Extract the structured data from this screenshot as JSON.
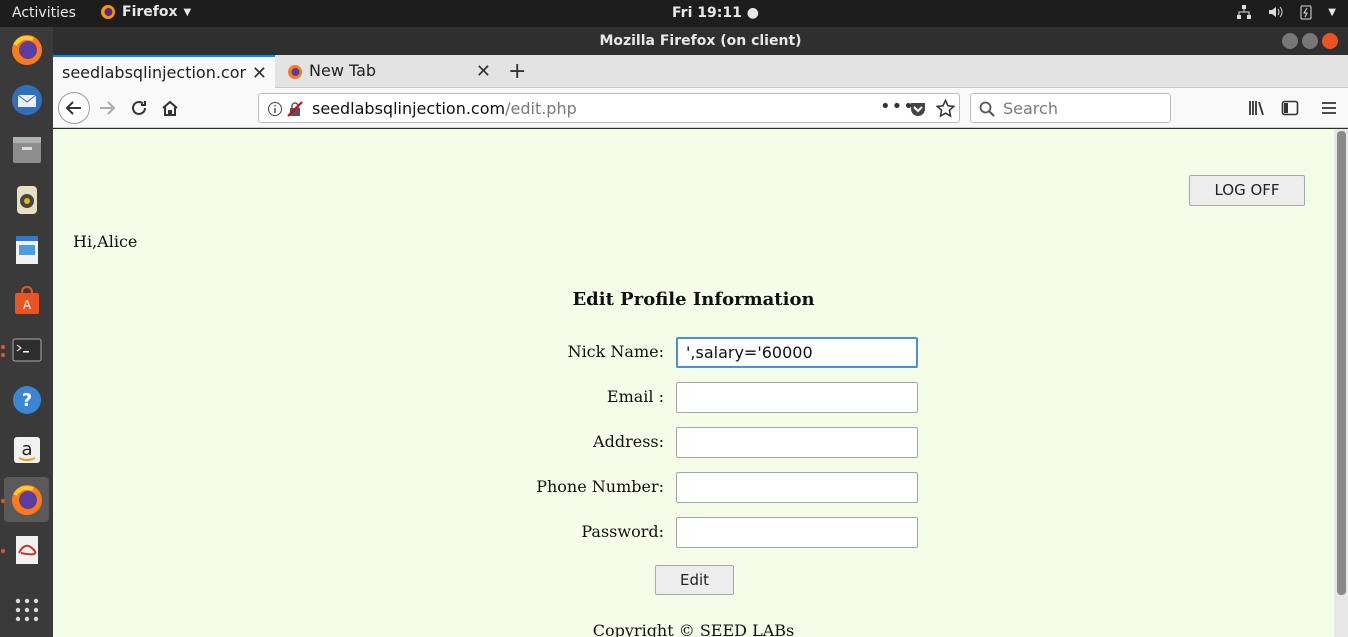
{
  "system": {
    "activities": "Activities",
    "app_name": "Firefox",
    "clock": "Fri 19:11"
  },
  "window": {
    "title": "Mozilla Firefox (on client)"
  },
  "tabs": [
    {
      "label": "seedlabsqlinjection.com/",
      "active": true
    },
    {
      "label": "New Tab",
      "active": false
    }
  ],
  "navbar": {
    "url_host": "seedlabsqlinjection.com",
    "url_path": "/edit.php",
    "search_placeholder": "Search"
  },
  "page": {
    "logoff_label": "LOG OFF",
    "greeting": "Hi,Alice",
    "form_title": "Edit Profile Information",
    "fields": [
      {
        "label": "Nick Name:",
        "value": "',salary='60000"
      },
      {
        "label": "Email :",
        "value": ""
      },
      {
        "label": "Address:",
        "value": ""
      },
      {
        "label": "Phone Number:",
        "value": ""
      },
      {
        "label": "Password:",
        "value": ""
      }
    ],
    "edit_label": "Edit",
    "copyright": "Copyright © SEED LABs"
  },
  "colors": {
    "page_bg": "#f5fde9",
    "accent": "#e95420",
    "focus": "#4a90d9"
  }
}
